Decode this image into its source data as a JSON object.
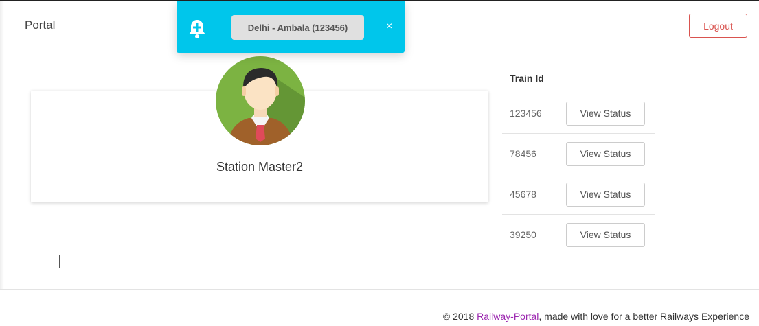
{
  "navbar": {
    "brand": "Portal",
    "logout_label": "Logout"
  },
  "notification": {
    "route_label": "Delhi - Ambala (123456)",
    "close_glyph": "×",
    "icon": "bell-plus-icon",
    "color": "#00c6eb"
  },
  "profile": {
    "name": "Station Master2",
    "avatar": "user-avatar"
  },
  "trains": {
    "headers": [
      "Train Id",
      ""
    ],
    "rows": [
      {
        "id": "123456",
        "action": "View Status"
      },
      {
        "id": "78456",
        "action": "View Status"
      },
      {
        "id": "45678",
        "action": "View Status"
      },
      {
        "id": "39250",
        "action": "View Status"
      }
    ]
  },
  "footer": {
    "copyright": "© 2018 ",
    "link_text": "Railway-Portal",
    "rest": ", made with love for a better Railways Experience",
    "link_color": "#9c27b0"
  },
  "colors": {
    "logout": "#d9534f",
    "accent": "#00c6eb"
  }
}
